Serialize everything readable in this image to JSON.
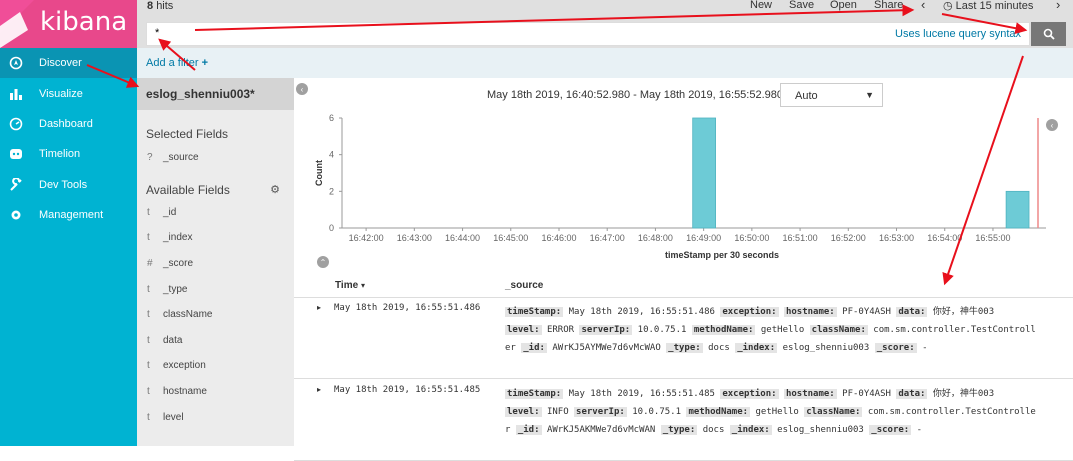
{
  "app": {
    "logo_text": "kibana"
  },
  "sidebar": {
    "items": [
      {
        "label": "Discover",
        "icon": "compass-icon"
      },
      {
        "label": "Visualize",
        "icon": "bar-chart-icon"
      },
      {
        "label": "Dashboard",
        "icon": "dashboard-icon"
      },
      {
        "label": "Timelion",
        "icon": "timelion-icon"
      },
      {
        "label": "Dev Tools",
        "icon": "wrench-icon"
      },
      {
        "label": "Management",
        "icon": "gear-icon"
      }
    ]
  },
  "topbar": {
    "hits_count": "8",
    "hits_label": "hits",
    "menu": {
      "new": "New",
      "save": "Save",
      "open": "Open",
      "share": "Share"
    },
    "time_label": "Last 15 minutes"
  },
  "search": {
    "query": "*",
    "lucene_label": "Uses lucene query syntax"
  },
  "filter": {
    "add_label": "Add a filter",
    "add_icon": "+"
  },
  "fields": {
    "index_pattern": "eslog_shenniu003*",
    "selected_title": "Selected Fields",
    "selected": [
      {
        "type": "?",
        "name": "_source"
      }
    ],
    "available_title": "Available Fields",
    "available": [
      {
        "type": "t",
        "name": "_id"
      },
      {
        "type": "t",
        "name": "_index"
      },
      {
        "type": "#",
        "name": "_score"
      },
      {
        "type": "t",
        "name": "_type"
      },
      {
        "type": "t",
        "name": "className"
      },
      {
        "type": "t",
        "name": "data"
      },
      {
        "type": "t",
        "name": "exception"
      },
      {
        "type": "t",
        "name": "hostname"
      },
      {
        "type": "t",
        "name": "level"
      }
    ]
  },
  "main": {
    "date_range": "May 18th 2019, 16:40:52.980 - May 18th 2019, 16:55:52.980 —",
    "interval": "Auto"
  },
  "chart_data": {
    "type": "bar",
    "ylabel": "Count",
    "xlabel": "timeStamp per 30 seconds",
    "ylim": [
      0,
      6
    ],
    "yticks": [
      "0",
      "2",
      "4",
      "6"
    ],
    "xticks": [
      "16:42:00",
      "16:43:00",
      "16:44:00",
      "16:45:00",
      "16:46:00",
      "16:47:00",
      "16:48:00",
      "16:49:00",
      "16:50:00",
      "16:51:00",
      "16:52:00",
      "16:53:00",
      "16:54:00",
      "16:55:00"
    ],
    "bars": [
      {
        "x": "16:49:00",
        "value": 6
      },
      {
        "x": "16:55:30",
        "value": 2
      }
    ],
    "bar_color": "#6dcbd6",
    "now_line_color": "#e88"
  },
  "table": {
    "col_time": "Time",
    "col_source": "_source",
    "rows": [
      {
        "time": "May 18th 2019, 16:55:51.486",
        "line1": [
          [
            "timeStamp:",
            "May 18th 2019, 16:55:51.486"
          ],
          [
            "exception:",
            ""
          ],
          [
            "hostname:",
            "PF-0Y4ASH"
          ],
          [
            "data:",
            "你好，神牛003"
          ]
        ],
        "line2": [
          [
            "level:",
            "ERROR"
          ],
          [
            "serverIp:",
            "10.0.75.1"
          ],
          [
            "methodName:",
            "getHello"
          ],
          [
            "className:",
            "com.sm.controller.TestControll"
          ]
        ],
        "line3_prefix": "er",
        "line3": [
          [
            "_id:",
            "AWrKJ5AYMWe7d6vMcWAO"
          ],
          [
            "_type:",
            "docs"
          ],
          [
            "_index:",
            "eslog_shenniu003"
          ],
          [
            "_score:",
            "-"
          ]
        ]
      },
      {
        "time": "May 18th 2019, 16:55:51.485",
        "line1": [
          [
            "timeStamp:",
            "May 18th 2019, 16:55:51.485"
          ],
          [
            "exception:",
            ""
          ],
          [
            "hostname:",
            "PF-0Y4ASH"
          ],
          [
            "data:",
            "你好，神牛003"
          ]
        ],
        "line2": [
          [
            "level:",
            "INFO"
          ],
          [
            "serverIp:",
            "10.0.75.1"
          ],
          [
            "methodName:",
            "getHello"
          ],
          [
            "className:",
            "com.sm.controller.TestControlle"
          ]
        ],
        "line3_prefix": "r",
        "line3": [
          [
            "_id:",
            "AWrKJ5AKMWe7d6vMcWAN"
          ],
          [
            "_type:",
            "docs"
          ],
          [
            "_index:",
            "eslog_shenniu003"
          ],
          [
            "_score:",
            "-"
          ]
        ]
      }
    ]
  },
  "colors": {
    "sidebar_bg": "#00b3d2",
    "logo_bg": "#e8488b",
    "annotation_arrow": "#e8101c"
  }
}
